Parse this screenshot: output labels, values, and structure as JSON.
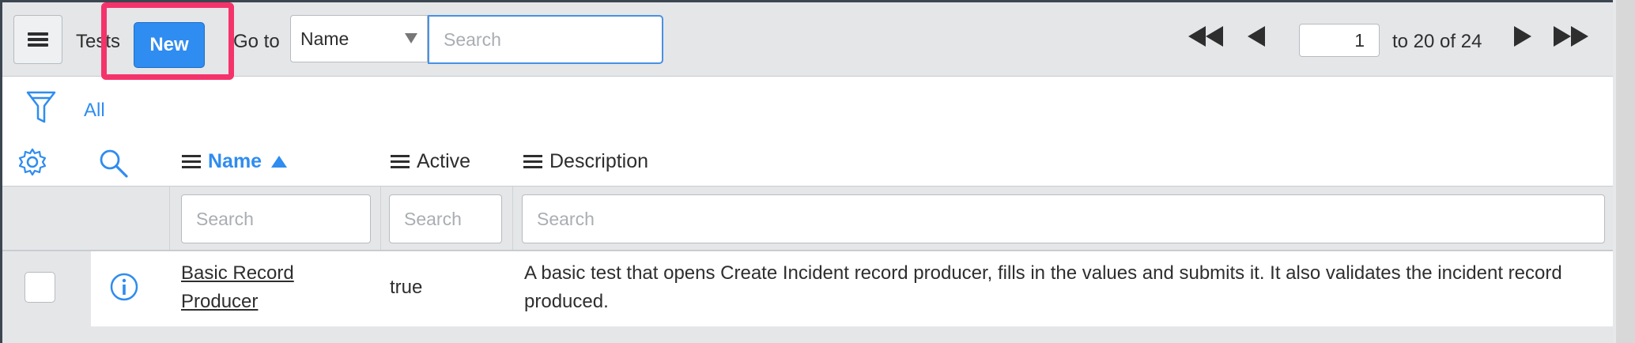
{
  "header": {
    "title": "Tests",
    "new_label": "New",
    "goto_label": "Go to",
    "field_select_value": "Name",
    "search_placeholder": "Search"
  },
  "pagination": {
    "current_page": "1",
    "range_text": "to 20 of 24"
  },
  "filter": {
    "label": "All"
  },
  "columns": [
    {
      "label": "Name"
    },
    {
      "label": "Active"
    },
    {
      "label": "Description"
    }
  ],
  "column_search_placeholder": "Search",
  "rows": [
    {
      "name": "Basic Record Producer",
      "active": "true",
      "description": "A basic test that opens Create Incident record producer, fills in the values and submits it. It also validates the incident record produced."
    }
  ],
  "colors": {
    "accent": "#2f8cf0",
    "highlight": "#f4336b",
    "header_bg": "#e4e6e8"
  }
}
